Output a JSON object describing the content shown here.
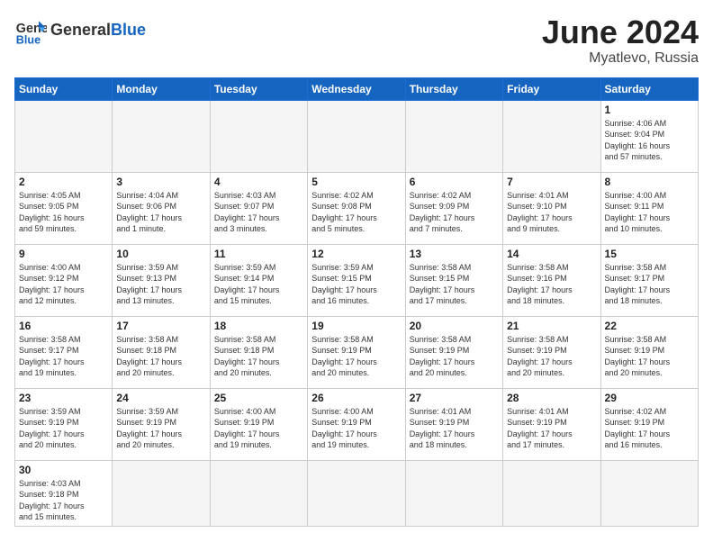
{
  "header": {
    "logo_general": "General",
    "logo_blue": "Blue",
    "month": "June 2024",
    "location": "Myatlevo, Russia"
  },
  "weekdays": [
    "Sunday",
    "Monday",
    "Tuesday",
    "Wednesday",
    "Thursday",
    "Friday",
    "Saturday"
  ],
  "weeks": [
    [
      {
        "day": "",
        "info": ""
      },
      {
        "day": "",
        "info": ""
      },
      {
        "day": "",
        "info": ""
      },
      {
        "day": "",
        "info": ""
      },
      {
        "day": "",
        "info": ""
      },
      {
        "day": "",
        "info": ""
      },
      {
        "day": "1",
        "info": "Sunrise: 4:06 AM\nSunset: 9:04 PM\nDaylight: 16 hours\nand 57 minutes."
      }
    ],
    [
      {
        "day": "2",
        "info": "Sunrise: 4:05 AM\nSunset: 9:05 PM\nDaylight: 16 hours\nand 59 minutes."
      },
      {
        "day": "3",
        "info": "Sunrise: 4:04 AM\nSunset: 9:06 PM\nDaylight: 17 hours\nand 1 minute."
      },
      {
        "day": "4",
        "info": "Sunrise: 4:03 AM\nSunset: 9:07 PM\nDaylight: 17 hours\nand 3 minutes."
      },
      {
        "day": "5",
        "info": "Sunrise: 4:02 AM\nSunset: 9:08 PM\nDaylight: 17 hours\nand 5 minutes."
      },
      {
        "day": "6",
        "info": "Sunrise: 4:02 AM\nSunset: 9:09 PM\nDaylight: 17 hours\nand 7 minutes."
      },
      {
        "day": "7",
        "info": "Sunrise: 4:01 AM\nSunset: 9:10 PM\nDaylight: 17 hours\nand 9 minutes."
      },
      {
        "day": "8",
        "info": "Sunrise: 4:00 AM\nSunset: 9:11 PM\nDaylight: 17 hours\nand 10 minutes."
      }
    ],
    [
      {
        "day": "9",
        "info": "Sunrise: 4:00 AM\nSunset: 9:12 PM\nDaylight: 17 hours\nand 12 minutes."
      },
      {
        "day": "10",
        "info": "Sunrise: 3:59 AM\nSunset: 9:13 PM\nDaylight: 17 hours\nand 13 minutes."
      },
      {
        "day": "11",
        "info": "Sunrise: 3:59 AM\nSunset: 9:14 PM\nDaylight: 17 hours\nand 15 minutes."
      },
      {
        "day": "12",
        "info": "Sunrise: 3:59 AM\nSunset: 9:15 PM\nDaylight: 17 hours\nand 16 minutes."
      },
      {
        "day": "13",
        "info": "Sunrise: 3:58 AM\nSunset: 9:15 PM\nDaylight: 17 hours\nand 17 minutes."
      },
      {
        "day": "14",
        "info": "Sunrise: 3:58 AM\nSunset: 9:16 PM\nDaylight: 17 hours\nand 18 minutes."
      },
      {
        "day": "15",
        "info": "Sunrise: 3:58 AM\nSunset: 9:17 PM\nDaylight: 17 hours\nand 18 minutes."
      }
    ],
    [
      {
        "day": "16",
        "info": "Sunrise: 3:58 AM\nSunset: 9:17 PM\nDaylight: 17 hours\nand 19 minutes."
      },
      {
        "day": "17",
        "info": "Sunrise: 3:58 AM\nSunset: 9:18 PM\nDaylight: 17 hours\nand 20 minutes."
      },
      {
        "day": "18",
        "info": "Sunrise: 3:58 AM\nSunset: 9:18 PM\nDaylight: 17 hours\nand 20 minutes."
      },
      {
        "day": "19",
        "info": "Sunrise: 3:58 AM\nSunset: 9:19 PM\nDaylight: 17 hours\nand 20 minutes."
      },
      {
        "day": "20",
        "info": "Sunrise: 3:58 AM\nSunset: 9:19 PM\nDaylight: 17 hours\nand 20 minutes."
      },
      {
        "day": "21",
        "info": "Sunrise: 3:58 AM\nSunset: 9:19 PM\nDaylight: 17 hours\nand 20 minutes."
      },
      {
        "day": "22",
        "info": "Sunrise: 3:58 AM\nSunset: 9:19 PM\nDaylight: 17 hours\nand 20 minutes."
      }
    ],
    [
      {
        "day": "23",
        "info": "Sunrise: 3:59 AM\nSunset: 9:19 PM\nDaylight: 17 hours\nand 20 minutes."
      },
      {
        "day": "24",
        "info": "Sunrise: 3:59 AM\nSunset: 9:19 PM\nDaylight: 17 hours\nand 20 minutes."
      },
      {
        "day": "25",
        "info": "Sunrise: 4:00 AM\nSunset: 9:19 PM\nDaylight: 17 hours\nand 19 minutes."
      },
      {
        "day": "26",
        "info": "Sunrise: 4:00 AM\nSunset: 9:19 PM\nDaylight: 17 hours\nand 19 minutes."
      },
      {
        "day": "27",
        "info": "Sunrise: 4:01 AM\nSunset: 9:19 PM\nDaylight: 17 hours\nand 18 minutes."
      },
      {
        "day": "28",
        "info": "Sunrise: 4:01 AM\nSunset: 9:19 PM\nDaylight: 17 hours\nand 17 minutes."
      },
      {
        "day": "29",
        "info": "Sunrise: 4:02 AM\nSunset: 9:19 PM\nDaylight: 17 hours\nand 16 minutes."
      }
    ],
    [
      {
        "day": "30",
        "info": "Sunrise: 4:03 AM\nSunset: 9:18 PM\nDaylight: 17 hours\nand 15 minutes."
      },
      {
        "day": "",
        "info": ""
      },
      {
        "day": "",
        "info": ""
      },
      {
        "day": "",
        "info": ""
      },
      {
        "day": "",
        "info": ""
      },
      {
        "day": "",
        "info": ""
      },
      {
        "day": "",
        "info": ""
      }
    ]
  ]
}
